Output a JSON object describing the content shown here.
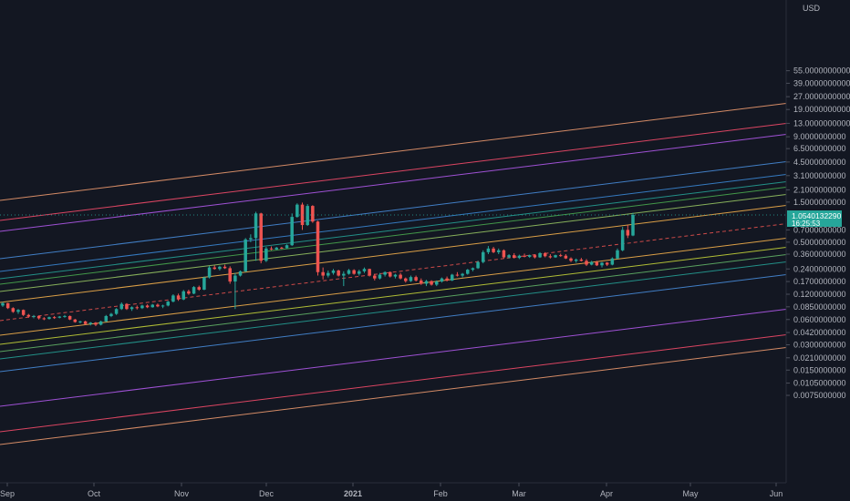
{
  "chart_data": {
    "type": "candlestick",
    "scale": "log",
    "title": "",
    "xlabel": "",
    "ylabel": "",
    "currency": "USD",
    "grid": false,
    "ylim": [
      0.0068,
      60
    ],
    "x_ticks": [
      "Sep",
      "Oct",
      "Nov",
      "Dec",
      "2021",
      "Feb",
      "Mar",
      "Apr",
      "May",
      "Jun"
    ],
    "y_ticks": [
      "55.0000000000",
      "39.0000000000",
      "27.0000000000",
      "19.0000000000",
      "13.0000000000",
      "9.0000000000",
      "6.5000000000",
      "4.5000000000",
      "3.1000000000",
      "2.1000000000",
      "1.5000000000",
      "1.0540132290",
      "0.7000000000",
      "0.5000000000",
      "0.3600000000",
      "0.2400000000",
      "0.1700000000",
      "0.1200000000",
      "0.0850000000",
      "0.0600000000",
      "0.0420000000",
      "0.0300000000",
      "0.0210000000",
      "0.0150000000",
      "0.0105000000",
      "0.0075000000"
    ],
    "last_price": {
      "value": "1.0540132290",
      "countdown": "16:25:53",
      "color": "#26a69a"
    },
    "colors": {
      "up": "#26a69a",
      "down": "#ef5350",
      "background": "#131722",
      "axis_text": "#b2b5be"
    },
    "channel_lines": [
      {
        "name": "band-upper-5",
        "color": "#f7a072",
        "dashed": false
      },
      {
        "name": "band-upper-4",
        "color": "#ff4d6d",
        "dashed": false
      },
      {
        "name": "band-upper-3",
        "color": "#b95cf4",
        "dashed": false
      },
      {
        "name": "band-upper-2",
        "color": "#4a90e2",
        "dashed": false
      },
      {
        "name": "band-upper-1a",
        "color": "#3c8cdc",
        "dashed": false
      },
      {
        "name": "band-upper-1b",
        "color": "#26a69a",
        "dashed": false
      },
      {
        "name": "band-upper-1c",
        "color": "#4caf50",
        "dashed": false
      },
      {
        "name": "band-upper-1d",
        "color": "#9ccc65",
        "dashed": false
      },
      {
        "name": "band-upper-1e",
        "color": "#ffb74d",
        "dashed": false
      },
      {
        "name": "band-median",
        "color": "#ef5350",
        "dashed": true
      },
      {
        "name": "band-lower-1a",
        "color": "#ffb74d",
        "dashed": false
      },
      {
        "name": "band-lower-1b",
        "color": "#cddc39",
        "dashed": false
      },
      {
        "name": "band-lower-1c",
        "color": "#66bb6a",
        "dashed": false
      },
      {
        "name": "band-lower-1d",
        "color": "#26a69a",
        "dashed": false
      },
      {
        "name": "band-lower-2",
        "color": "#4a90e2",
        "dashed": false
      },
      {
        "name": "band-lower-3",
        "color": "#b95cf4",
        "dashed": false
      },
      {
        "name": "band-lower-4",
        "color": "#ff4d6d",
        "dashed": false
      },
      {
        "name": "band-lower-5",
        "color": "#f7a072",
        "dashed": false
      }
    ],
    "candles": [
      [
        0.088,
        0.097,
        0.085,
        0.094
      ],
      [
        0.094,
        0.095,
        0.08,
        0.082
      ],
      [
        0.082,
        0.084,
        0.072,
        0.074
      ],
      [
        0.074,
        0.08,
        0.07,
        0.078
      ],
      [
        0.078,
        0.079,
        0.066,
        0.068
      ],
      [
        0.068,
        0.07,
        0.063,
        0.065
      ],
      [
        0.065,
        0.068,
        0.062,
        0.066
      ],
      [
        0.066,
        0.067,
        0.06,
        0.062
      ],
      [
        0.062,
        0.064,
        0.059,
        0.061
      ],
      [
        0.061,
        0.065,
        0.06,
        0.064
      ],
      [
        0.064,
        0.066,
        0.061,
        0.063
      ],
      [
        0.063,
        0.066,
        0.062,
        0.065
      ],
      [
        0.065,
        0.068,
        0.063,
        0.066
      ],
      [
        0.066,
        0.067,
        0.059,
        0.06
      ],
      [
        0.06,
        0.061,
        0.055,
        0.056
      ],
      [
        0.056,
        0.058,
        0.054,
        0.057
      ],
      [
        0.057,
        0.058,
        0.052,
        0.053
      ],
      [
        0.053,
        0.056,
        0.051,
        0.055
      ],
      [
        0.055,
        0.056,
        0.05,
        0.052
      ],
      [
        0.052,
        0.058,
        0.051,
        0.057
      ],
      [
        0.057,
        0.068,
        0.056,
        0.066
      ],
      [
        0.066,
        0.072,
        0.064,
        0.07
      ],
      [
        0.07,
        0.082,
        0.068,
        0.08
      ],
      [
        0.08,
        0.096,
        0.078,
        0.092
      ],
      [
        0.092,
        0.094,
        0.078,
        0.08
      ],
      [
        0.08,
        0.086,
        0.076,
        0.084
      ],
      [
        0.084,
        0.088,
        0.079,
        0.082
      ],
      [
        0.082,
        0.09,
        0.08,
        0.088
      ],
      [
        0.088,
        0.091,
        0.082,
        0.084
      ],
      [
        0.084,
        0.092,
        0.083,
        0.09
      ],
      [
        0.09,
        0.093,
        0.084,
        0.086
      ],
      [
        0.086,
        0.09,
        0.082,
        0.088
      ],
      [
        0.088,
        0.1,
        0.086,
        0.098
      ],
      [
        0.098,
        0.12,
        0.096,
        0.116
      ],
      [
        0.116,
        0.122,
        0.1,
        0.104
      ],
      [
        0.104,
        0.135,
        0.102,
        0.13
      ],
      [
        0.13,
        0.136,
        0.118,
        0.122
      ],
      [
        0.122,
        0.15,
        0.12,
        0.146
      ],
      [
        0.146,
        0.152,
        0.132,
        0.136
      ],
      [
        0.136,
        0.195,
        0.134,
        0.19
      ],
      [
        0.19,
        0.26,
        0.185,
        0.25
      ],
      [
        0.25,
        0.265,
        0.235,
        0.24
      ],
      [
        0.24,
        0.262,
        0.23,
        0.255
      ],
      [
        0.255,
        0.27,
        0.24,
        0.245
      ],
      [
        0.245,
        0.258,
        0.16,
        0.17
      ],
      [
        0.17,
        0.215,
        0.08,
        0.2
      ],
      [
        0.2,
        0.23,
        0.195,
        0.225
      ],
      [
        0.225,
        0.56,
        0.22,
        0.54
      ],
      [
        0.54,
        0.62,
        0.5,
        0.56
      ],
      [
        0.56,
        1.15,
        0.3,
        1.1
      ],
      [
        1.1,
        1.12,
        0.28,
        0.3
      ],
      [
        0.3,
        0.44,
        0.29,
        0.42
      ],
      [
        0.42,
        0.445,
        0.4,
        0.41
      ],
      [
        0.41,
        0.44,
        0.405,
        0.43
      ],
      [
        0.43,
        0.44,
        0.415,
        0.425
      ],
      [
        0.425,
        0.47,
        0.42,
        0.46
      ],
      [
        0.46,
        1.1,
        0.45,
        1.0
      ],
      [
        1.0,
        1.45,
        0.98,
        1.4
      ],
      [
        1.4,
        1.48,
        0.7,
        0.8
      ],
      [
        0.8,
        1.42,
        0.78,
        1.35
      ],
      [
        1.35,
        1.38,
        0.85,
        0.88
      ],
      [
        0.88,
        0.9,
        0.2,
        0.22
      ],
      [
        0.22,
        0.25,
        0.18,
        0.2
      ],
      [
        0.2,
        0.23,
        0.19,
        0.215
      ],
      [
        0.215,
        0.24,
        0.205,
        0.23
      ],
      [
        0.23,
        0.235,
        0.195,
        0.2
      ],
      [
        0.2,
        0.225,
        0.15,
        0.21
      ],
      [
        0.21,
        0.24,
        0.205,
        0.232
      ],
      [
        0.232,
        0.238,
        0.205,
        0.21
      ],
      [
        0.21,
        0.235,
        0.2,
        0.225
      ],
      [
        0.225,
        0.25,
        0.215,
        0.24
      ],
      [
        0.24,
        0.242,
        0.195,
        0.2
      ],
      [
        0.2,
        0.21,
        0.175,
        0.185
      ],
      [
        0.185,
        0.215,
        0.18,
        0.205
      ],
      [
        0.205,
        0.225,
        0.195,
        0.22
      ],
      [
        0.22,
        0.224,
        0.19,
        0.195
      ],
      [
        0.195,
        0.21,
        0.185,
        0.205
      ],
      [
        0.205,
        0.215,
        0.18,
        0.185
      ],
      [
        0.185,
        0.19,
        0.165,
        0.172
      ],
      [
        0.172,
        0.2,
        0.168,
        0.192
      ],
      [
        0.192,
        0.2,
        0.17,
        0.175
      ],
      [
        0.175,
        0.185,
        0.155,
        0.16
      ],
      [
        0.16,
        0.178,
        0.15,
        0.172
      ],
      [
        0.172,
        0.176,
        0.152,
        0.156
      ],
      [
        0.156,
        0.175,
        0.15,
        0.17
      ],
      [
        0.17,
        0.19,
        0.165,
        0.185
      ],
      [
        0.185,
        0.195,
        0.17,
        0.175
      ],
      [
        0.175,
        0.21,
        0.172,
        0.205
      ],
      [
        0.205,
        0.22,
        0.195,
        0.2
      ],
      [
        0.2,
        0.215,
        0.19,
        0.21
      ],
      [
        0.21,
        0.24,
        0.205,
        0.235
      ],
      [
        0.235,
        0.25,
        0.225,
        0.245
      ],
      [
        0.245,
        0.3,
        0.24,
        0.29
      ],
      [
        0.29,
        0.4,
        0.28,
        0.38
      ],
      [
        0.38,
        0.45,
        0.36,
        0.42
      ],
      [
        0.42,
        0.44,
        0.37,
        0.38
      ],
      [
        0.38,
        0.42,
        0.36,
        0.4
      ],
      [
        0.4,
        0.41,
        0.32,
        0.33
      ],
      [
        0.33,
        0.36,
        0.32,
        0.35
      ],
      [
        0.35,
        0.37,
        0.32,
        0.325
      ],
      [
        0.325,
        0.355,
        0.315,
        0.345
      ],
      [
        0.345,
        0.365,
        0.33,
        0.335
      ],
      [
        0.335,
        0.355,
        0.325,
        0.35
      ],
      [
        0.35,
        0.36,
        0.32,
        0.33
      ],
      [
        0.33,
        0.38,
        0.325,
        0.37
      ],
      [
        0.37,
        0.38,
        0.33,
        0.34
      ],
      [
        0.34,
        0.36,
        0.32,
        0.33
      ],
      [
        0.33,
        0.355,
        0.325,
        0.35
      ],
      [
        0.35,
        0.365,
        0.335,
        0.345
      ],
      [
        0.345,
        0.36,
        0.315,
        0.32
      ],
      [
        0.32,
        0.33,
        0.29,
        0.3
      ],
      [
        0.3,
        0.32,
        0.285,
        0.31
      ],
      [
        0.31,
        0.325,
        0.295,
        0.3
      ],
      [
        0.3,
        0.315,
        0.26,
        0.27
      ],
      [
        0.27,
        0.3,
        0.265,
        0.29
      ],
      [
        0.29,
        0.3,
        0.26,
        0.265
      ],
      [
        0.265,
        0.29,
        0.25,
        0.285
      ],
      [
        0.285,
        0.29,
        0.26,
        0.27
      ],
      [
        0.27,
        0.33,
        0.265,
        0.32
      ],
      [
        0.32,
        0.42,
        0.315,
        0.4
      ],
      [
        0.4,
        0.76,
        0.39,
        0.7
      ],
      [
        0.7,
        0.8,
        0.56,
        0.6
      ],
      [
        0.6,
        1.12,
        0.59,
        1.054
      ]
    ]
  }
}
